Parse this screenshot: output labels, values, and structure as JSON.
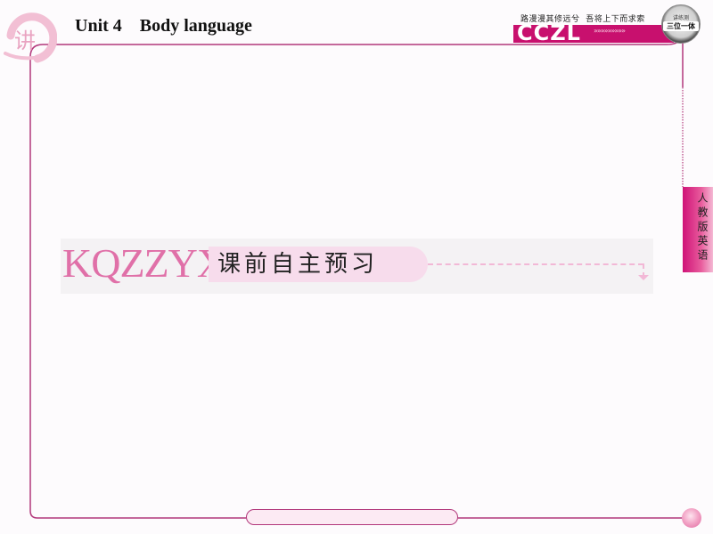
{
  "header": {
    "logo_char": "讲",
    "unit": "Unit 4",
    "title": "Body language",
    "full_title": "Unit 4    Body language"
  },
  "brand": {
    "slogan": "路漫漫其修远兮  吾将上下而求索",
    "name": "CCZL",
    "arrows": "»»»»»»»»»",
    "badge_top": "讲练测",
    "badge_main": "三位一体",
    "primary_color": "#c8106e"
  },
  "side_tab": {
    "label": "人教版英语"
  },
  "section": {
    "code": "KQZZYX",
    "label": "课前自主预习",
    "code_color": "#e070a8",
    "pill_color": "#f7dcec"
  },
  "colors": {
    "frame_line": "#b2377b",
    "accent_pink": "#cf1277"
  }
}
